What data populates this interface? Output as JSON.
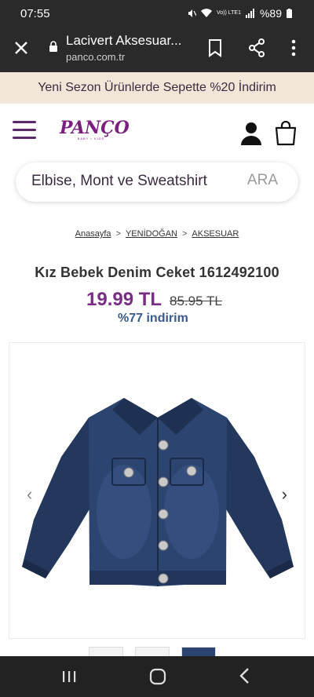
{
  "status": {
    "time": "07:55",
    "battery": "%89",
    "network": "Vo)) LTE1"
  },
  "browser": {
    "title": "Lacivert Aksesuar...",
    "url": "panco.com.tr"
  },
  "promo": {
    "text": "Yeni Sezon Ürünlerde Sepette %20 İndirim"
  },
  "header": {
    "logo": "PANÇO",
    "logo_tagline": "BABY • KIDS"
  },
  "search": {
    "placeholder": "Elbise, Mont ve Sweatshirt",
    "button_label": "ARA"
  },
  "breadcrumb": {
    "items": [
      "Anasayfa",
      "YENİDOĞAN",
      "AKSESUAR"
    ],
    "separator": ">"
  },
  "product": {
    "title": "Kız Bebek Denim Ceket 1612492100",
    "price": "19.99 TL",
    "old_price": "85.95 TL",
    "discount": "%77 indirim"
  },
  "gallery": {
    "prev_icon": "‹",
    "next_icon": "›"
  },
  "colors": {
    "brand": "#7a1f7f",
    "price": "#7a2d86",
    "discount": "#3b5a8a",
    "promo_bg": "#f2e6d8",
    "denim": "#24385e"
  }
}
